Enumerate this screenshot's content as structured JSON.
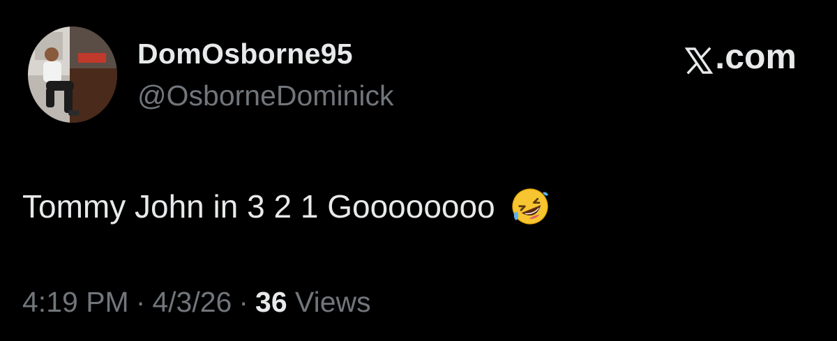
{
  "author": {
    "display_name": "DomOsborne95",
    "handle": "@OsborneDominick"
  },
  "brand": {
    "suffix": ".com",
    "logo_icon": "x-logo-icon"
  },
  "tweet": {
    "text": "Tommy John in 3 2 1 Goooooooo",
    "emoji_icon": "rolling-on-floor-laughing-emoji"
  },
  "meta": {
    "time": "4:19 PM",
    "separator": "·",
    "date": "4/3/26",
    "views_count": "36",
    "views_label": "Views"
  },
  "colors": {
    "background": "#000000",
    "primary_text": "#e7e9ea",
    "secondary_text": "#71767b"
  }
}
